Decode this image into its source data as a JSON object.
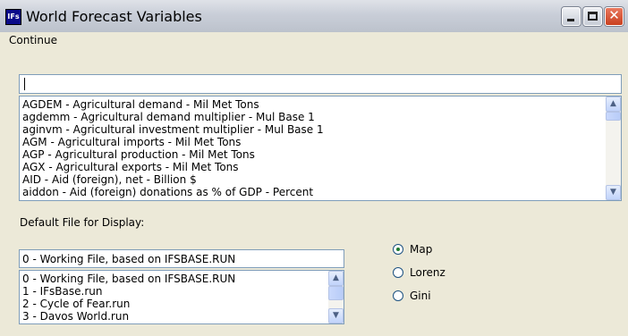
{
  "window": {
    "app_icon_text": "IFs",
    "title": "World Forecast Variables"
  },
  "menu": {
    "items": [
      "Continue"
    ]
  },
  "search": {
    "value": ""
  },
  "variables": [
    "AGDEM - Agricultural demand - Mil Met Tons",
    "agdemm - Agricultural demand multiplier - Mul Base 1",
    "aginvm - Agricultural investment multiplier - Mul Base 1",
    "AGM - Agricultural imports - Mil Met Tons",
    "AGP - Agricultural production - Mil Met Tons",
    "AGX - Agricultural exports - Mil Met Tons",
    "AID - Aid (foreign), net - Billion $",
    "aiddon - Aid (foreign) donations as % of GDP - Percent"
  ],
  "default_file": {
    "label": "Default File for Display:",
    "selected": "0 - Working File, based on IFSBASE.RUN",
    "options": [
      "0 - Working File, based on IFSBASE.RUN",
      "1 - IFsBase.run",
      "2 - Cycle of Fear.run",
      "3 - Davos World.run"
    ]
  },
  "display_mode": {
    "options": [
      {
        "label": "Map",
        "checked": true
      },
      {
        "label": "Lorenz",
        "checked": false
      },
      {
        "label": "Gini",
        "checked": false
      }
    ]
  },
  "icons": {
    "scroll_up": "▲",
    "scroll_down": "▼",
    "close": "✕"
  }
}
